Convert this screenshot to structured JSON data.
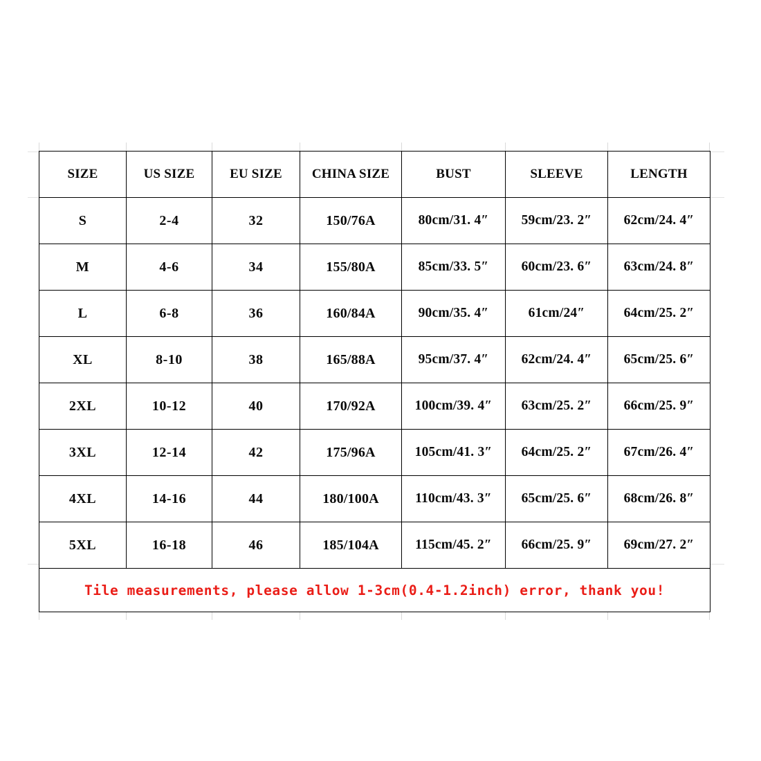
{
  "table": {
    "columns": [
      {
        "key": "size",
        "label": "SIZE"
      },
      {
        "key": "us",
        "label": "US SIZE"
      },
      {
        "key": "eu",
        "label": "EU SIZE"
      },
      {
        "key": "china",
        "label": "CHINA SIZE"
      },
      {
        "key": "bust",
        "label": "BUST"
      },
      {
        "key": "sleeve",
        "label": "SLEEVE"
      },
      {
        "key": "length",
        "label": "LENGTH"
      }
    ],
    "rows": [
      {
        "size": "S",
        "us": "2-4",
        "eu": "32",
        "china": "150/76A",
        "bust": "80cm/31. 4″",
        "sleeve": "59cm/23. 2″",
        "length": "62cm/24. 4″"
      },
      {
        "size": "M",
        "us": "4-6",
        "eu": "34",
        "china": "155/80A",
        "bust": "85cm/33. 5″",
        "sleeve": "60cm/23. 6″",
        "length": "63cm/24. 8″"
      },
      {
        "size": "L",
        "us": "6-8",
        "eu": "36",
        "china": "160/84A",
        "bust": "90cm/35. 4″",
        "sleeve": "61cm/24″",
        "length": "64cm/25. 2″"
      },
      {
        "size": "XL",
        "us": "8-10",
        "eu": "38",
        "china": "165/88A",
        "bust": "95cm/37. 4″",
        "sleeve": "62cm/24. 4″",
        "length": "65cm/25. 6″"
      },
      {
        "size": "2XL",
        "us": "10-12",
        "eu": "40",
        "china": "170/92A",
        "bust": "100cm/39. 4″",
        "sleeve": "63cm/25. 2″",
        "length": "66cm/25. 9″"
      },
      {
        "size": "3XL",
        "us": "12-14",
        "eu": "42",
        "china": "175/96A",
        "bust": "105cm/41. 3″",
        "sleeve": "64cm/25. 2″",
        "length": "67cm/26. 4″"
      },
      {
        "size": "4XL",
        "us": "14-16",
        "eu": "44",
        "china": "180/100A",
        "bust": "110cm/43. 3″",
        "sleeve": "65cm/25. 6″",
        "length": "68cm/26. 8″"
      },
      {
        "size": "5XL",
        "us": "16-18",
        "eu": "46",
        "china": "185/104A",
        "bust": "115cm/45. 2″",
        "sleeve": "66cm/25. 9″",
        "length": "69cm/27. 2″"
      }
    ],
    "footer_note": "Tile measurements, please allow 1-3cm(0.4-1.2inch) error, thank you!"
  },
  "colors": {
    "text": "#0a0a0a",
    "border": "#000000",
    "note": "#ea1d17",
    "background": "#ffffff",
    "gridline": "#d9d9d9"
  }
}
